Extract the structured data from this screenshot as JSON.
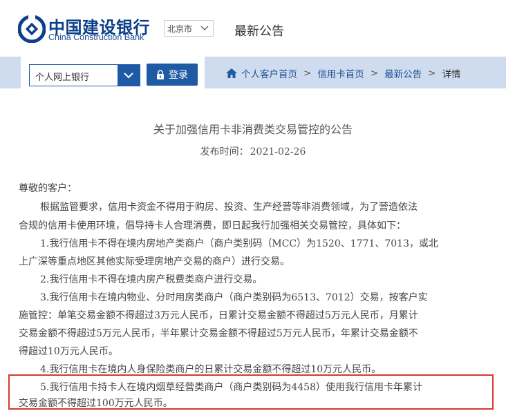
{
  "header": {
    "brand_cn": "中国建设银行",
    "brand_en": "China Construction Bank",
    "city": "北京市",
    "page_heading": "最新公告"
  },
  "login": {
    "channel": "个人网上银行",
    "login_label": "登录"
  },
  "breadcrumb": {
    "items": [
      "个人客户首页",
      "信用卡首页",
      "最新公告"
    ],
    "separator": ">",
    "current": "详情"
  },
  "article": {
    "title": "关于加强信用卡非消费类交易管控的公告",
    "date_label": "发布时间：",
    "date": "2021-02-26",
    "lines": [
      "尊敬的客户：",
      "根据监管要求，信用卡资金不得用于购房、投资、生产经营等非消费领域，为了营造依法",
      "合规的信用卡使用环境，倡导持卡人合理消费，即日起我行加强相关交易管控，具体如下：",
      "1.我行信用卡不得在境内房地产类商户（商户类别码（MCC）为1520、1771、7013，或北",
      "上广深等重点地区其他实际受理房地产交易的商户）进行交易。",
      "2.我行信用卡不得在境内房产税费类商户进行交易。",
      "3.我行信用卡在境内物业、分时用房类商户（商户类别码为6513、7012）交易，按客户实",
      "施管控：单笔交易金额不得超过3万元人民币，日累计交易金额不得超过5万元人民币，月累计",
      "交易金额不得超过5万元人民币，半年累计交易金额不得超过5万元人民币，年累计交易金额不",
      "得超过10万元人民币。",
      "4.我行信用卡在境内人身保险类商户的日累计交易金额不得超过10万元人民币。",
      "5.我行信用卡持卡人在境内烟草经营类商户（商户类别码为4458）使用我行信用卡年累计",
      "交易金额不得超过100万元人民币。"
    ]
  },
  "colors": {
    "brand_blue": "#0b3f8a",
    "button_blue": "#1f5aa5",
    "bar_blue": "#cfdcef",
    "highlight_red": "#d9352f"
  },
  "icons": [
    "ccb-logo-icon",
    "chevron-down-icon",
    "lock-icon",
    "home-icon"
  ]
}
